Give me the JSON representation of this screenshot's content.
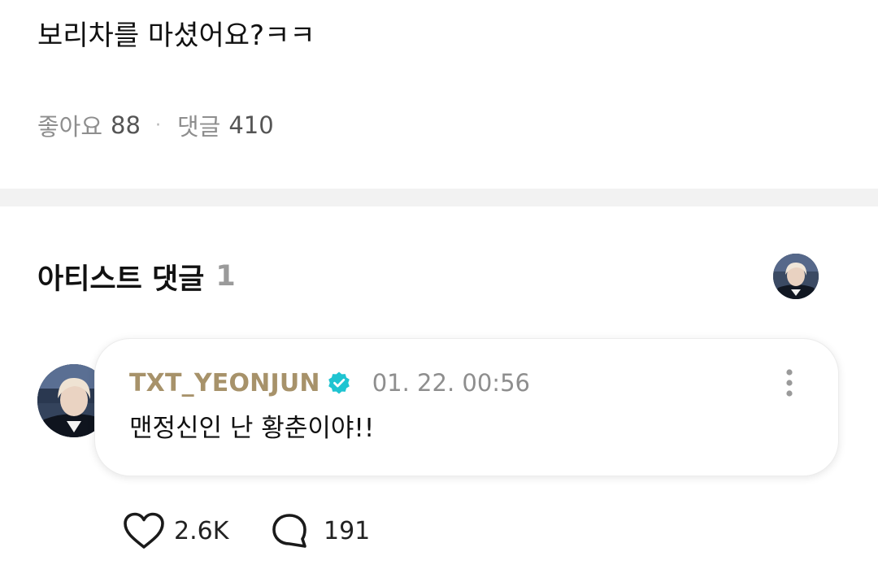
{
  "post": {
    "text": "보리차를 마셨어요?ㅋㅋ",
    "likes_label": "좋아요",
    "likes_count": "88",
    "separator": "·",
    "comments_label": "댓글",
    "comments_count": "410"
  },
  "artist_comments": {
    "title": "아티스트 댓글",
    "count": "1",
    "header_avatar_icon": "artist-avatar-icon"
  },
  "comment": {
    "author": "TXT_YEONJUN",
    "author_color": "#a7926a",
    "verified_icon": "verified-badge-icon",
    "verified_color": "#1fc4d1",
    "timestamp": "01. 22. 00:56",
    "body": "맨정신인 난 황춘이야!!",
    "more_icon": "more-vertical-icon",
    "like_icon": "heart-icon",
    "like_count": "2.6K",
    "reply_icon": "speech-bubble-icon",
    "reply_count": "191"
  }
}
